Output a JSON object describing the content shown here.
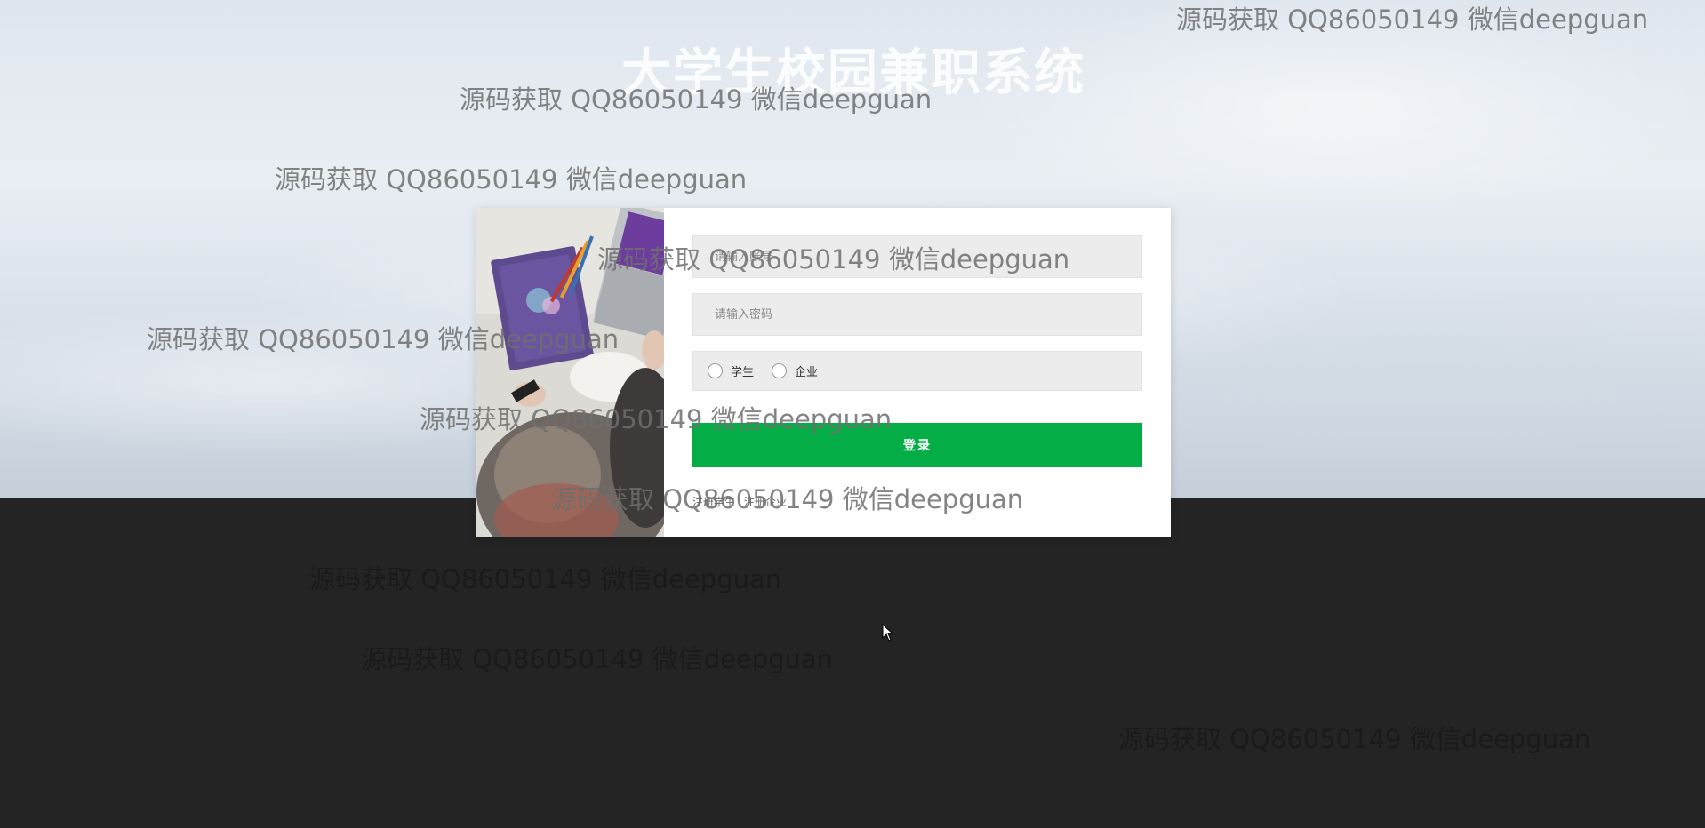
{
  "app": {
    "title": "大学生校园兼职系统"
  },
  "login": {
    "username_placeholder": "请输入账号",
    "password_placeholder": "请输入密码",
    "roles": [
      {
        "label": "学生",
        "selected": false
      },
      {
        "label": "企业",
        "selected": false
      }
    ],
    "submit_label": "登录",
    "register_student": "注册学生",
    "register_company": "注册企业"
  },
  "watermark": {
    "text": "源码获取 QQ86050149 微信deepguan"
  },
  "colors": {
    "primary_button": "#05ad47",
    "footer_background": "#242424",
    "card_background": "#ffffff",
    "field_background": "#ececec"
  },
  "icons": {
    "radio": "radio-empty-circle",
    "cursor": "mouse-pointer-arrow"
  }
}
